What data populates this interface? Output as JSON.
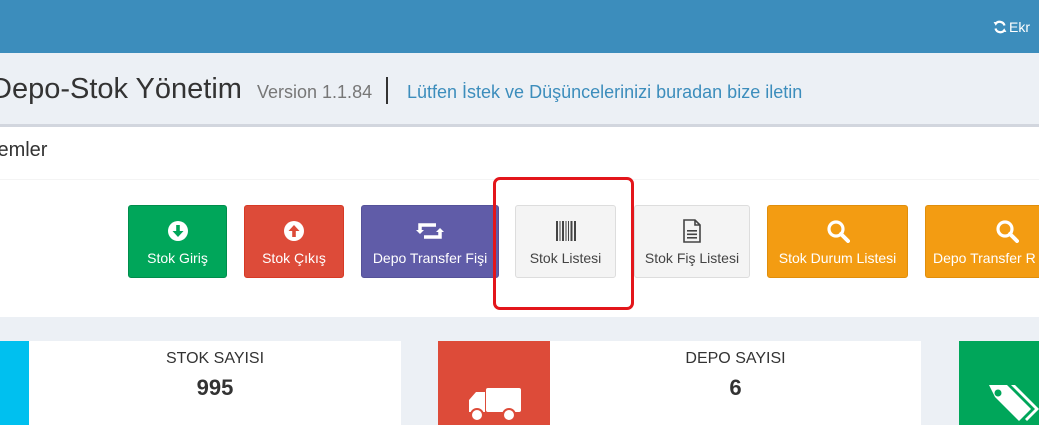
{
  "header": {
    "refresh_label": "Ekr"
  },
  "app": {
    "title": "Depo-Stok Yönetim",
    "version": "Version 1.1.84",
    "feedback_link": "Lütfen İstek ve Düşüncelerinizi buradan bize iletin"
  },
  "panel": {
    "title": "lemler",
    "buttons": [
      {
        "label": "Stok Giriş",
        "icon": "arrow-circle-down-icon",
        "color": "#00a65a"
      },
      {
        "label": "Stok Çıkış",
        "icon": "arrow-circle-up-icon",
        "color": "#dd4b39"
      },
      {
        "label": "Depo Transfer Fişi",
        "icon": "retweet-icon",
        "color": "#605ca8"
      },
      {
        "label": "Stok Listesi",
        "icon": "barcode-icon",
        "color": "#f4f4f4"
      },
      {
        "label": "Stok Fiş Listesi",
        "icon": "file-text-icon",
        "color": "#f4f4f4"
      },
      {
        "label": "Stok Durum Listesi",
        "icon": "search-icon",
        "color": "#f39c12"
      },
      {
        "label": "Depo Transfer R",
        "icon": "search-icon",
        "color": "#f39c12"
      }
    ]
  },
  "stats": [
    {
      "label": "STOK SAYISI",
      "value": "995",
      "color": "#00c0ef"
    },
    {
      "label": "DEPO SAYISI",
      "value": "6",
      "color": "#dd4b39",
      "icon": "truck-icon"
    },
    {
      "color": "#00a65a",
      "icon": "tags-icon"
    }
  ]
}
